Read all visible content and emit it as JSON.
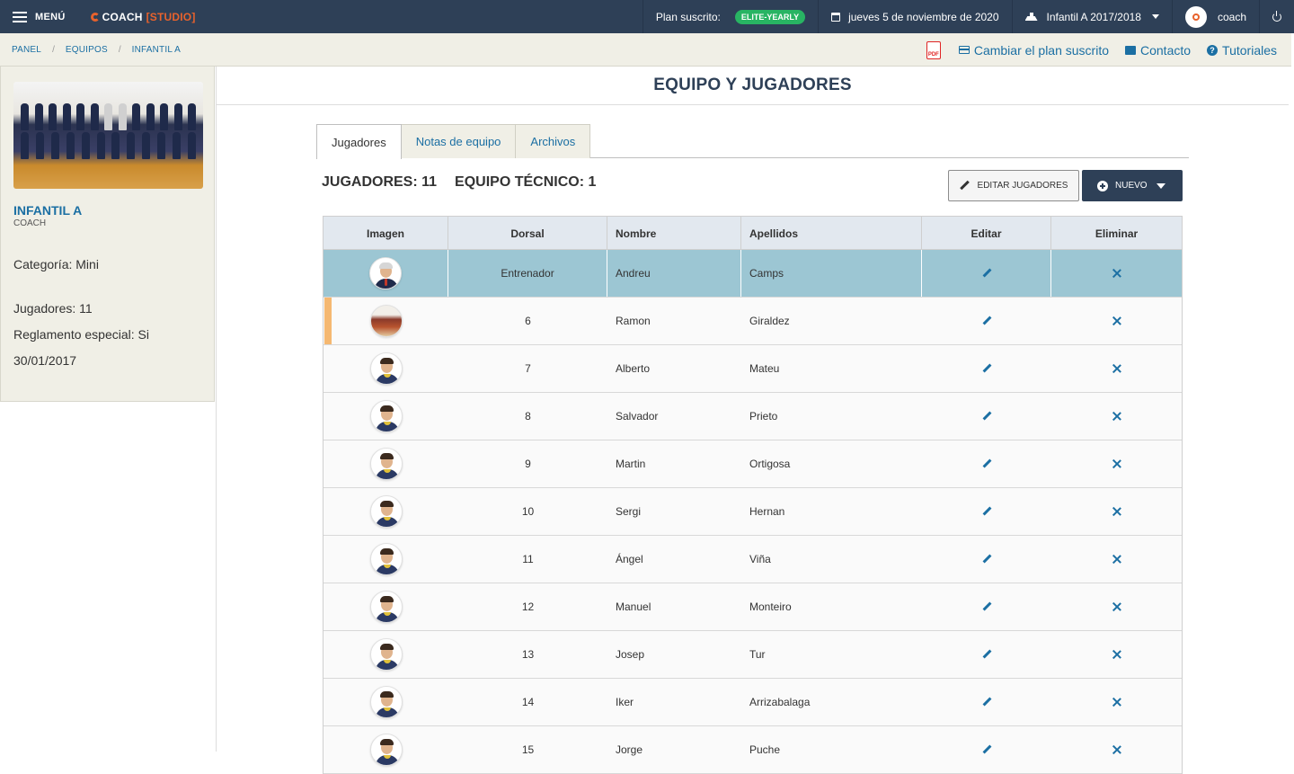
{
  "topbar": {
    "menu_label": "MENÚ",
    "logo_text": "COACH",
    "logo_studio": "[STUDIO]",
    "plan_label": "Plan suscrito:",
    "plan_badge": "ELITE-YEARLY",
    "date": "jueves 5 de noviembre de 2020",
    "team_selector": "Infantil A 2017/2018",
    "user_name": "coach",
    "colors": {
      "bar": "#2e4057",
      "badge": "#28b463",
      "brand": "#e8622c"
    }
  },
  "breadcrumb": {
    "items": [
      "PANEL",
      "EQUIPOS",
      "INFANTIL A"
    ],
    "pdf_icon": "pdf-icon",
    "actions": {
      "change_plan": "Cambiar el plan suscrito",
      "contact": "Contacto",
      "tutorials": "Tutoriales"
    }
  },
  "team_panel": {
    "name": "INFANTIL A",
    "role": "COACH",
    "category": "Categoría: Mini",
    "players": "Jugadores: 11",
    "rules": "Reglamento especial: Si",
    "date": "30/01/2017"
  },
  "main": {
    "title": "EQUIPO Y JUGADORES",
    "tabs": [
      "Jugadores",
      "Notas de equipo",
      "Archivos"
    ],
    "active_tab": "Jugadores",
    "counts": {
      "players": "JUGADORES: 11",
      "staff": "EQUIPO TÉCNICO: 1"
    },
    "buttons": {
      "edit_players": "EDITAR JUGADORES",
      "new": "NUEVO"
    }
  },
  "table": {
    "headers": [
      "Imagen",
      "Dorsal",
      "Nombre",
      "Apellidos",
      "Editar",
      "Eliminar"
    ],
    "rows": [
      {
        "dorsal": "Entrenador",
        "nombre": "Andreu",
        "apellidos": "Camps"
      },
      {
        "dorsal": "6",
        "nombre": "Ramon",
        "apellidos": "Giraldez"
      },
      {
        "dorsal": "7",
        "nombre": "Alberto",
        "apellidos": "Mateu"
      },
      {
        "dorsal": "8",
        "nombre": "Salvador",
        "apellidos": "Prieto"
      },
      {
        "dorsal": "9",
        "nombre": "Martin",
        "apellidos": "Ortigosa"
      },
      {
        "dorsal": "10",
        "nombre": "Sergi",
        "apellidos": "Hernan"
      },
      {
        "dorsal": "11",
        "nombre": "Ángel",
        "apellidos": "Viña"
      },
      {
        "dorsal": "12",
        "nombre": "Manuel",
        "apellidos": "Monteiro"
      },
      {
        "dorsal": "13",
        "nombre": "Josep",
        "apellidos": "Tur"
      },
      {
        "dorsal": "14",
        "nombre": "Iker",
        "apellidos": "Arrizabalaga"
      },
      {
        "dorsal": "15",
        "nombre": "Jorge",
        "apellidos": "Puche"
      }
    ],
    "colors": {
      "header": "#e2e8ef",
      "selected_row": "#9cc6d3",
      "row_marker": "#f5b871",
      "action": "#1b6fa3"
    }
  }
}
